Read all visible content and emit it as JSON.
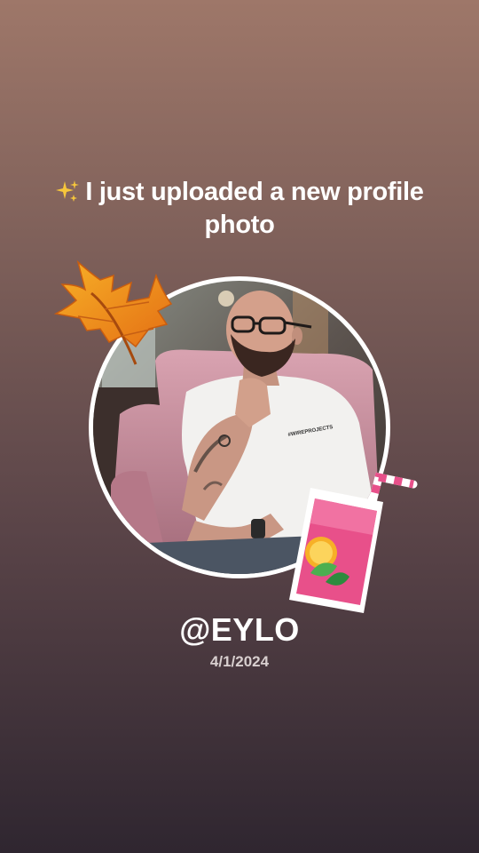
{
  "headline": {
    "sparkle_icon": "sparkles-icon",
    "text": "I just uploaded a new profile photo"
  },
  "profile": {
    "photo_icon": "profile-photo",
    "shirt_print": "#WIREPROJECTS"
  },
  "stickers": {
    "leaf": "maple-leaf-icon",
    "drink": "cocktail-glass-icon"
  },
  "username": "@EYLO",
  "date": "4/1/2024",
  "colors": {
    "text": "#ffffff",
    "date_text": "#d8cfcf",
    "ring": "#ffffff",
    "leaf": "#f08a1c",
    "drink": "#e8508a"
  }
}
